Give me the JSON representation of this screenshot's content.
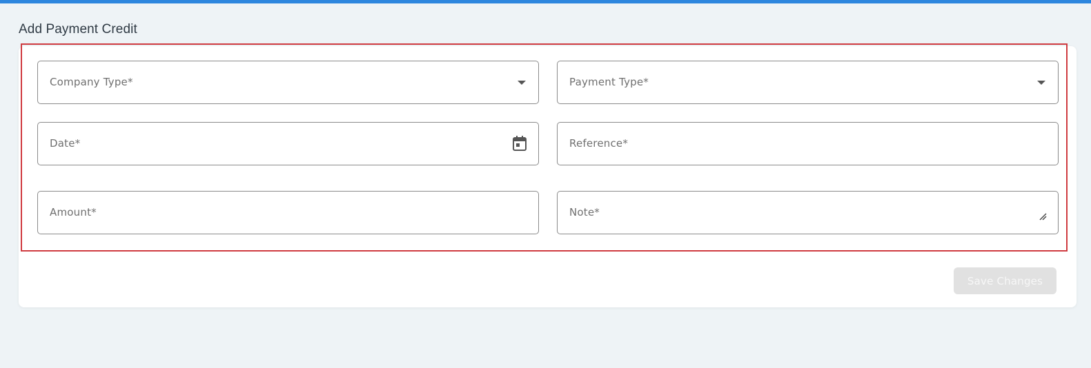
{
  "page": {
    "title": "Add Payment Credit"
  },
  "form": {
    "company_type": {
      "label": "Company Type*",
      "icon": "chevron-down-icon"
    },
    "payment_type": {
      "label": "Payment Type*",
      "icon": "chevron-down-icon"
    },
    "date": {
      "label": "Date*",
      "icon": "calendar-icon"
    },
    "reference": {
      "label": "Reference*"
    },
    "amount": {
      "label": "Amount*"
    },
    "note": {
      "label": "Note*",
      "icon": "resize-handle-icon"
    },
    "save_label": "Save Changes"
  },
  "colors": {
    "accent": "#2d86de",
    "highlight_border": "#cf3a3f",
    "background": "#eef3f6",
    "disabled_button": "#e1e1e1"
  }
}
